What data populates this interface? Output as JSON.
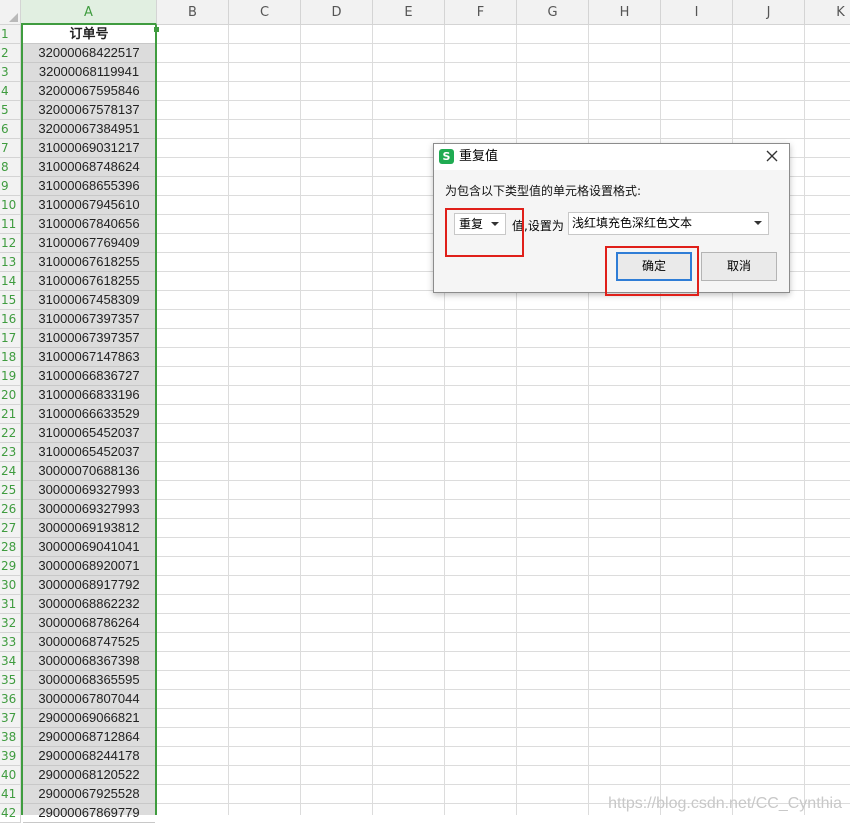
{
  "sheet": {
    "columns": [
      "A",
      "B",
      "C",
      "D",
      "E",
      "F",
      "G",
      "H",
      "I",
      "J",
      "K"
    ],
    "rows": [
      "1",
      "2",
      "3",
      "4",
      "5",
      "6",
      "7",
      "8",
      "9",
      "10",
      "11",
      "12",
      "13",
      "14",
      "15",
      "16",
      "17",
      "18",
      "19",
      "20",
      "21",
      "22",
      "23",
      "24",
      "25",
      "26",
      "27",
      "28",
      "29",
      "30",
      "31",
      "32",
      "33",
      "34",
      "35",
      "36",
      "37",
      "38",
      "39",
      "40",
      "41",
      "42"
    ],
    "header_cell": "订单号",
    "values": [
      "32000068422517",
      "32000068119941",
      "32000067595846",
      "32000067578137",
      "32000067384951",
      "31000069031217",
      "31000068748624",
      "31000068655396",
      "31000067945610",
      "31000067840656",
      "31000067769409",
      "31000067618255",
      "31000067618255",
      "31000067458309",
      "31000067397357",
      "31000067397357",
      "31000067147863",
      "31000066836727",
      "31000066833196",
      "31000066633529",
      "31000065452037",
      "31000065452037",
      "30000070688136",
      "30000069327993",
      "30000069327993",
      "30000069193812",
      "30000069041041",
      "30000068920071",
      "30000068917792",
      "30000068862232",
      "30000068786264",
      "30000068747525",
      "30000068367398",
      "30000068365595",
      "30000067807044",
      "29000069066821",
      "29000068712864",
      "29000068244178",
      "29000068120522",
      "29000067925528",
      "29000067869779"
    ],
    "selected_column": "A",
    "selection_color": "#3f9c3f"
  },
  "dialog": {
    "logo": "S",
    "title": "重复值",
    "prompt": "为包含以下类型值的单元格设置格式:",
    "rule_value": "重复",
    "connector": "值,设置为",
    "format_value": "浅红填充色深红色文本",
    "ok_label": "确定",
    "cancel_label": "取消",
    "highlight_color": "#e0201a"
  },
  "watermark": "https://blog.csdn.net/CC_Cynthia"
}
